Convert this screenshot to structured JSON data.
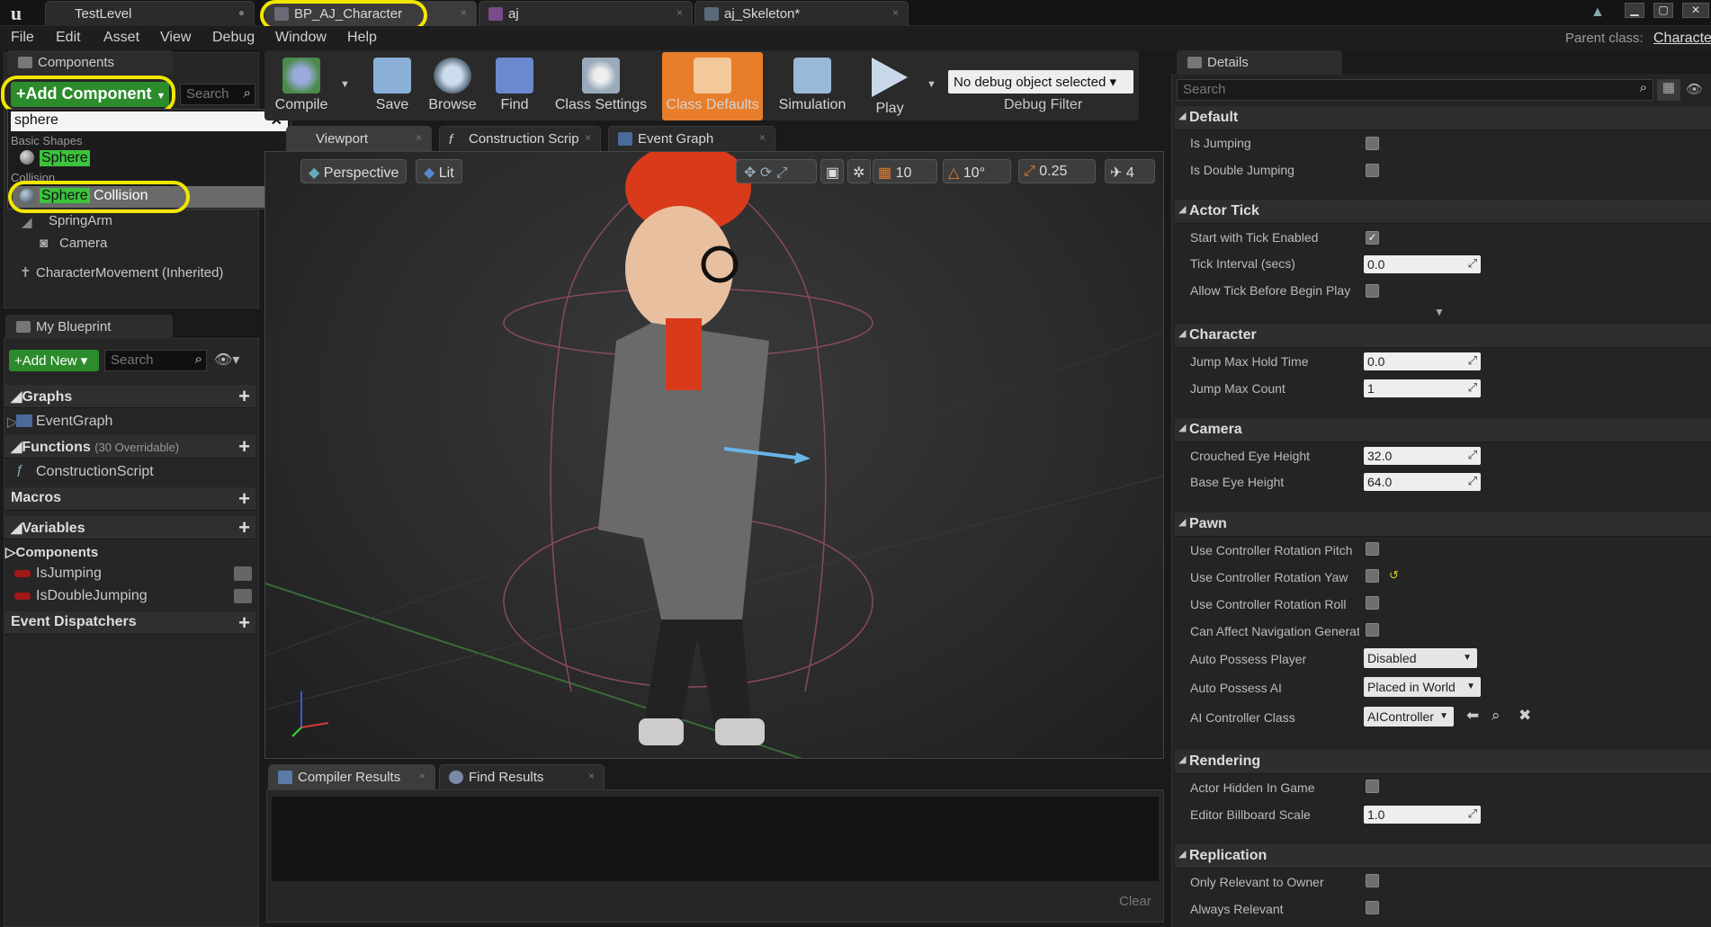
{
  "title_tabs": [
    {
      "label": "TestLevel"
    },
    {
      "label": "BP_AJ_Character"
    },
    {
      "label": "aj"
    },
    {
      "label": "aj_Skeleton*"
    }
  ],
  "menu": [
    "File",
    "Edit",
    "Asset",
    "View",
    "Debug",
    "Window",
    "Help"
  ],
  "parent_class": {
    "label": "Parent class:",
    "value": "Characte"
  },
  "components": {
    "title": "Components",
    "add_label": "+Add Component",
    "search_placeholder": "Search",
    "dropdown": {
      "query": "sphere",
      "cat1": "Basic Shapes",
      "item1": "Sphere",
      "cat2": "Collision",
      "item2_match": "Sphere",
      "item2_rest": " Collision"
    },
    "tree": [
      "SpringArm",
      "Camera",
      "CharacterMovement (Inherited)"
    ]
  },
  "my_blueprint": {
    "title": "My Blueprint",
    "add_label": "Add New",
    "search_placeholder": "Search",
    "graphs": "Graphs",
    "event_graph": "EventGraph",
    "functions": "Functions",
    "functions_note": "(30 Overridable)",
    "construction": "ConstructionScript",
    "macros": "Macros",
    "variables": "Variables",
    "components": "Components",
    "var1": "IsJumping",
    "var2": "IsDoubleJumping",
    "dispatchers": "Event Dispatchers"
  },
  "toolbar": {
    "compile": "Compile",
    "save": "Save",
    "browse": "Browse",
    "find": "Find",
    "class_settings": "Class Settings",
    "class_defaults": "Class Defaults",
    "simulation": "Simulation",
    "play": "Play",
    "debug_select": "No debug object selected",
    "debug_filter": "Debug Filter"
  },
  "editor_tabs": [
    "Viewport",
    "Construction Scrip",
    "Event Graph"
  ],
  "viewport": {
    "perspective": "Perspective",
    "lit": "Lit",
    "grid": "10",
    "angle": "10°",
    "scale": "0.25",
    "speed": "4"
  },
  "bottom": {
    "tab1": "Compiler Results",
    "tab2": "Find Results",
    "clear": "Clear"
  },
  "details": {
    "title": "Details",
    "search_placeholder": "Search",
    "default": "Default",
    "is_jumping": "Is Jumping",
    "is_double_jumping": "Is Double Jumping",
    "actor_tick": "Actor Tick",
    "start_tick": "Start with Tick Enabled",
    "tick_interval": "Tick Interval (secs)",
    "tick_interval_val": "0.0",
    "allow_tick": "Allow Tick Before Begin Play",
    "character": "Character",
    "jump_hold": "Jump Max Hold Time",
    "jump_hold_val": "0.0",
    "jump_count": "Jump Max Count",
    "jump_count_val": "1",
    "camera": "Camera",
    "crouched_eye": "Crouched Eye Height",
    "crouched_eye_val": "32.0",
    "base_eye": "Base Eye Height",
    "base_eye_val": "64.0",
    "pawn": "Pawn",
    "ucr_pitch": "Use Controller Rotation Pitch",
    "ucr_yaw": "Use Controller Rotation Yaw",
    "ucr_roll": "Use Controller Rotation Roll",
    "can_affect": "Can Affect Navigation Generation",
    "auto_player": "Auto Possess Player",
    "auto_player_val": "Disabled",
    "auto_ai": "Auto Possess AI",
    "auto_ai_val": "Placed in World",
    "ai_class": "AI Controller Class",
    "ai_class_val": "AIController",
    "rendering": "Rendering",
    "hidden": "Actor Hidden In Game",
    "billboard": "Editor Billboard Scale",
    "billboard_val": "1.0",
    "replication": "Replication",
    "only_relevant": "Only Relevant to Owner",
    "always_relevant": "Always Relevant"
  },
  "colors": {
    "highlight": "#f2e600",
    "accent": "#e87d2a",
    "green": "#2c8c2c"
  }
}
